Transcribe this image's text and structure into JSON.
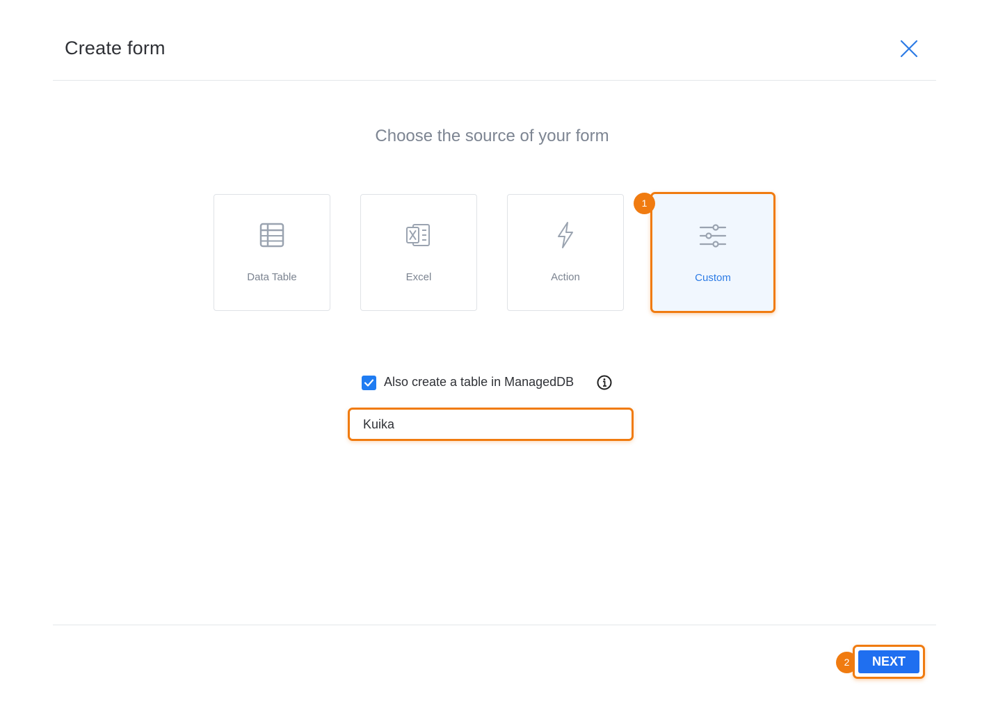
{
  "header": {
    "title": "Create form"
  },
  "main": {
    "subtitle": "Choose the source of your form",
    "sources": [
      {
        "label": "Data Table",
        "icon": "table-icon"
      },
      {
        "label": "Excel",
        "icon": "excel-icon"
      },
      {
        "label": "Action",
        "icon": "lightning-icon"
      },
      {
        "label": "Custom",
        "icon": "sliders-icon",
        "selected": true
      }
    ],
    "checkbox": {
      "label": "Also create a table in ManagedDB",
      "checked": true
    },
    "table_name_input": {
      "value": "Kuika"
    }
  },
  "footer": {
    "next_label": "NEXT"
  },
  "annotations": {
    "step1": "1",
    "step2": "2"
  },
  "colors": {
    "accent_blue": "#1f6ff0",
    "highlight_orange": "#f07b10",
    "selected_bg": "#f1f7fe"
  }
}
